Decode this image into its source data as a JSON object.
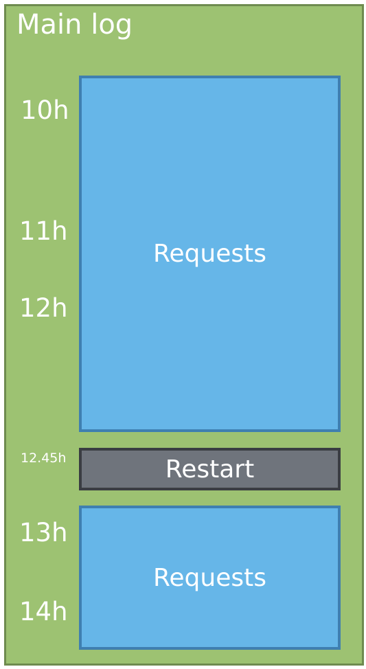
{
  "diagram": {
    "title": "Main log",
    "time_labels": {
      "t10": "10h",
      "t11": "11h",
      "t12": "12h",
      "t1245": "12.45h",
      "t13": "13h",
      "t14": "14h"
    },
    "blocks": {
      "requests_first": "Requests",
      "restart": "Restart",
      "requests_second": "Requests"
    }
  },
  "colors": {
    "panel_background": "#9dc272",
    "panel_border": "#6e8b4f",
    "requests_fill": "#66b6e8",
    "requests_border": "#3f7fb0",
    "restart_fill": "#6f747c",
    "restart_border": "#3a3d42",
    "text": "#ffffff"
  }
}
